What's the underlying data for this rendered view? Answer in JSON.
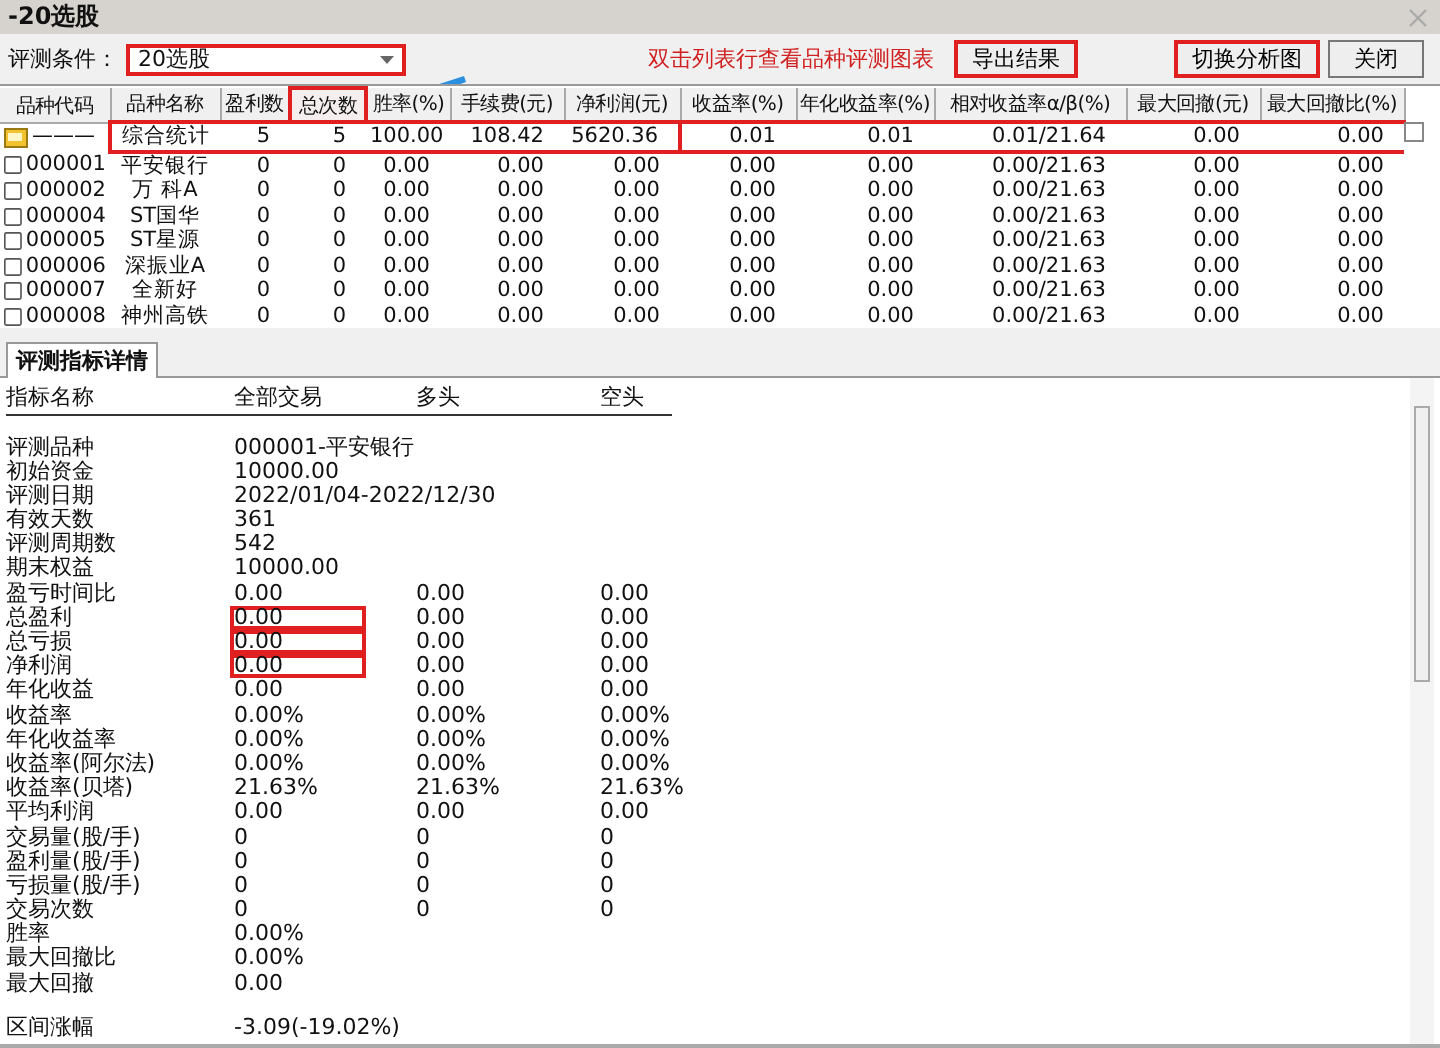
{
  "window": {
    "title": "-20选股"
  },
  "toolbar": {
    "condition_label": "评测条件：",
    "condition": {
      "value": "20选股",
      "highlighted": true
    },
    "hint": "双击列表行查看品种评测图表",
    "buttons": [
      {
        "label": "导出结果",
        "highlighted": true
      },
      {
        "label": "切换分析图",
        "highlighted": true
      },
      {
        "label": "关闭",
        "highlighted": false
      }
    ]
  },
  "table": {
    "columns": [
      {
        "label": "品种代码",
        "highlighted": false
      },
      {
        "label": "品种名称",
        "highlighted": false
      },
      {
        "label": "盈利数",
        "highlighted": false
      },
      {
        "label": "总次数",
        "highlighted": true
      },
      {
        "label": "胜率(%)",
        "highlighted": false
      },
      {
        "label": "手续费(元)",
        "highlighted": false
      },
      {
        "label": "净利润(元)",
        "highlighted": false
      },
      {
        "label": "收益率(%)",
        "highlighted": false
      },
      {
        "label": "年化收益率(%)",
        "highlighted": false
      },
      {
        "label": "相对收益率α/β(%)",
        "highlighted": false
      },
      {
        "label": "最大回撤(元)",
        "highlighted": false
      },
      {
        "label": "最大回撤比(%)",
        "highlighted": false
      }
    ],
    "rows": [
      {
        "kind": "summary",
        "highlighted": true,
        "cells": [
          "———",
          "综合统计",
          "5",
          "5",
          "100.00",
          "108.42",
          "5620.36",
          "0.01",
          "0.01",
          "0.01/21.64",
          "0.00",
          "0.00"
        ]
      },
      {
        "kind": "stock",
        "highlighted": false,
        "cells": [
          "000001",
          "平安银行",
          "0",
          "0",
          "0.00",
          "0.00",
          "0.00",
          "0.00",
          "0.00",
          "0.00/21.63",
          "0.00",
          "0.00"
        ]
      },
      {
        "kind": "stock",
        "highlighted": false,
        "cells": [
          "000002",
          "万 科A",
          "0",
          "0",
          "0.00",
          "0.00",
          "0.00",
          "0.00",
          "0.00",
          "0.00/21.63",
          "0.00",
          "0.00"
        ]
      },
      {
        "kind": "stock",
        "highlighted": false,
        "cells": [
          "000004",
          "ST国华",
          "0",
          "0",
          "0.00",
          "0.00",
          "0.00",
          "0.00",
          "0.00",
          "0.00/21.63",
          "0.00",
          "0.00"
        ]
      },
      {
        "kind": "stock",
        "highlighted": false,
        "cells": [
          "000005",
          "ST星源",
          "0",
          "0",
          "0.00",
          "0.00",
          "0.00",
          "0.00",
          "0.00",
          "0.00/21.63",
          "0.00",
          "0.00"
        ]
      },
      {
        "kind": "stock",
        "highlighted": false,
        "cells": [
          "000006",
          "深振业A",
          "0",
          "0",
          "0.00",
          "0.00",
          "0.00",
          "0.00",
          "0.00",
          "0.00/21.63",
          "0.00",
          "0.00"
        ]
      },
      {
        "kind": "stock",
        "highlighted": false,
        "cells": [
          "000007",
          "全新好",
          "0",
          "0",
          "0.00",
          "0.00",
          "0.00",
          "0.00",
          "0.00",
          "0.00/21.63",
          "0.00",
          "0.00"
        ]
      },
      {
        "kind": "stock",
        "highlighted": false,
        "cells": [
          "000008",
          "神州高铁",
          "0",
          "0",
          "0.00",
          "0.00",
          "0.00",
          "0.00",
          "0.00",
          "0.00/21.63",
          "0.00",
          "0.00"
        ]
      }
    ]
  },
  "details": {
    "tab": {
      "label": "评测指标详情",
      "selected": true
    },
    "columns": [
      "指标名称",
      "全部交易",
      "多头",
      "空头"
    ],
    "rows": [
      {
        "label": "评测品种",
        "values": [
          "000001-平安银行"
        ],
        "highlighted": false
      },
      {
        "label": "初始资金",
        "values": [
          "10000.00"
        ],
        "highlighted": false
      },
      {
        "label": "评测日期",
        "values": [
          "2022/01/04-2022/12/30"
        ],
        "highlighted": false
      },
      {
        "label": "有效天数",
        "values": [
          "361"
        ],
        "highlighted": false
      },
      {
        "label": "评测周期数",
        "values": [
          "542"
        ],
        "highlighted": false
      },
      {
        "label": "期末权益",
        "values": [
          "10000.00"
        ],
        "highlighted": false
      },
      {
        "label": "盈亏时间比",
        "values": [
          "0.00",
          "0.00",
          "0.00"
        ],
        "highlighted": false
      },
      {
        "label": "总盈利",
        "values": [
          "0.00",
          "0.00",
          "0.00"
        ],
        "highlighted": true
      },
      {
        "label": "总亏损",
        "values": [
          "0.00",
          "0.00",
          "0.00"
        ],
        "highlighted": true
      },
      {
        "label": "净利润",
        "values": [
          "0.00",
          "0.00",
          "0.00"
        ],
        "highlighted": true
      },
      {
        "label": "年化收益",
        "values": [
          "0.00",
          "0.00",
          "0.00"
        ],
        "highlighted": false
      },
      {
        "label": "收益率",
        "values": [
          "0.00%",
          "0.00%",
          "0.00%"
        ],
        "highlighted": false
      },
      {
        "label": "年化收益率",
        "values": [
          "0.00%",
          "0.00%",
          "0.00%"
        ],
        "highlighted": false
      },
      {
        "label": "收益率(阿尔法)",
        "values": [
          "0.00%",
          "0.00%",
          "0.00%"
        ],
        "highlighted": false
      },
      {
        "label": "收益率(贝塔)",
        "values": [
          "21.63%",
          "21.63%",
          "21.63%"
        ],
        "highlighted": false
      },
      {
        "label": "平均利润",
        "values": [
          "0.00",
          "0.00",
          "0.00"
        ],
        "highlighted": false
      },
      {
        "label": "交易量(股/手)",
        "values": [
          "0",
          "0",
          "0"
        ],
        "highlighted": false
      },
      {
        "label": "盈利量(股/手)",
        "values": [
          "0",
          "0",
          "0"
        ],
        "highlighted": false
      },
      {
        "label": "亏损量(股/手)",
        "values": [
          "0",
          "0",
          "0"
        ],
        "highlighted": false
      },
      {
        "label": "交易次数",
        "values": [
          "0",
          "0",
          "0"
        ],
        "highlighted": false
      },
      {
        "label": "胜率",
        "values": [
          "0.00%"
        ],
        "highlighted": false
      },
      {
        "label": "最大回撤比",
        "values": [
          "0.00%"
        ],
        "highlighted": false
      },
      {
        "label": "最大回撤",
        "values": [
          "0.00"
        ],
        "highlighted": false
      },
      {
        "label": "区间涨幅",
        "values": [
          "-3.09(-19.02%)"
        ],
        "highlighted": false,
        "separated": true
      }
    ]
  }
}
